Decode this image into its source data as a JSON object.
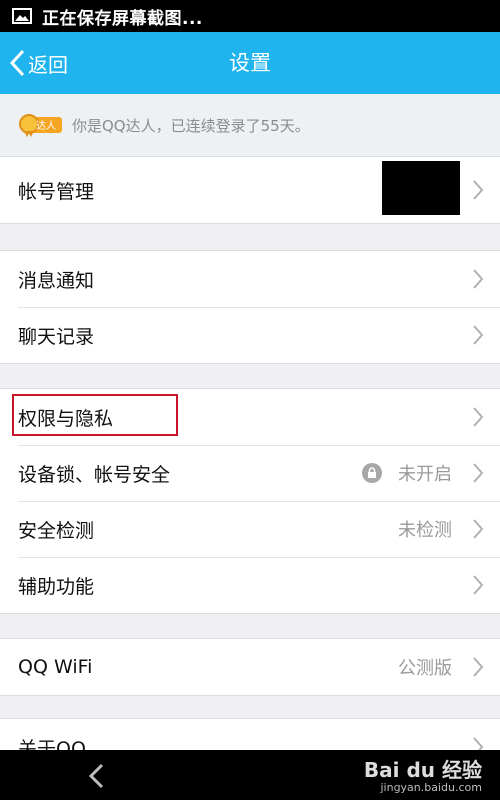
{
  "status_bar": {
    "text": "正在保存屏幕截图..."
  },
  "title_bar": {
    "back_label": "返回",
    "title": "设置"
  },
  "banner": {
    "text": "你是QQ达人，已连续登录了55天。",
    "badge_text": "达人"
  },
  "groups": [
    {
      "rows": [
        {
          "label": "帐号管理"
        }
      ]
    },
    {
      "rows": [
        {
          "label": "消息通知"
        },
        {
          "label": "聊天记录"
        }
      ]
    },
    {
      "rows": [
        {
          "label": "权限与隐私"
        },
        {
          "label": "设备锁、帐号安全",
          "value": "未开启"
        },
        {
          "label": "安全检测",
          "value": "未检测"
        },
        {
          "label": "辅助功能"
        }
      ]
    },
    {
      "rows": [
        {
          "label": "QQ WiFi",
          "value": "公测版"
        }
      ]
    },
    {
      "rows": [
        {
          "label": "关于QQ"
        }
      ]
    }
  ],
  "watermark": {
    "brand": "Bai du 经验",
    "sub": "jingyan.baidu.com"
  },
  "colors": {
    "accent": "#20b4ee",
    "highlight": "#c8152c"
  }
}
